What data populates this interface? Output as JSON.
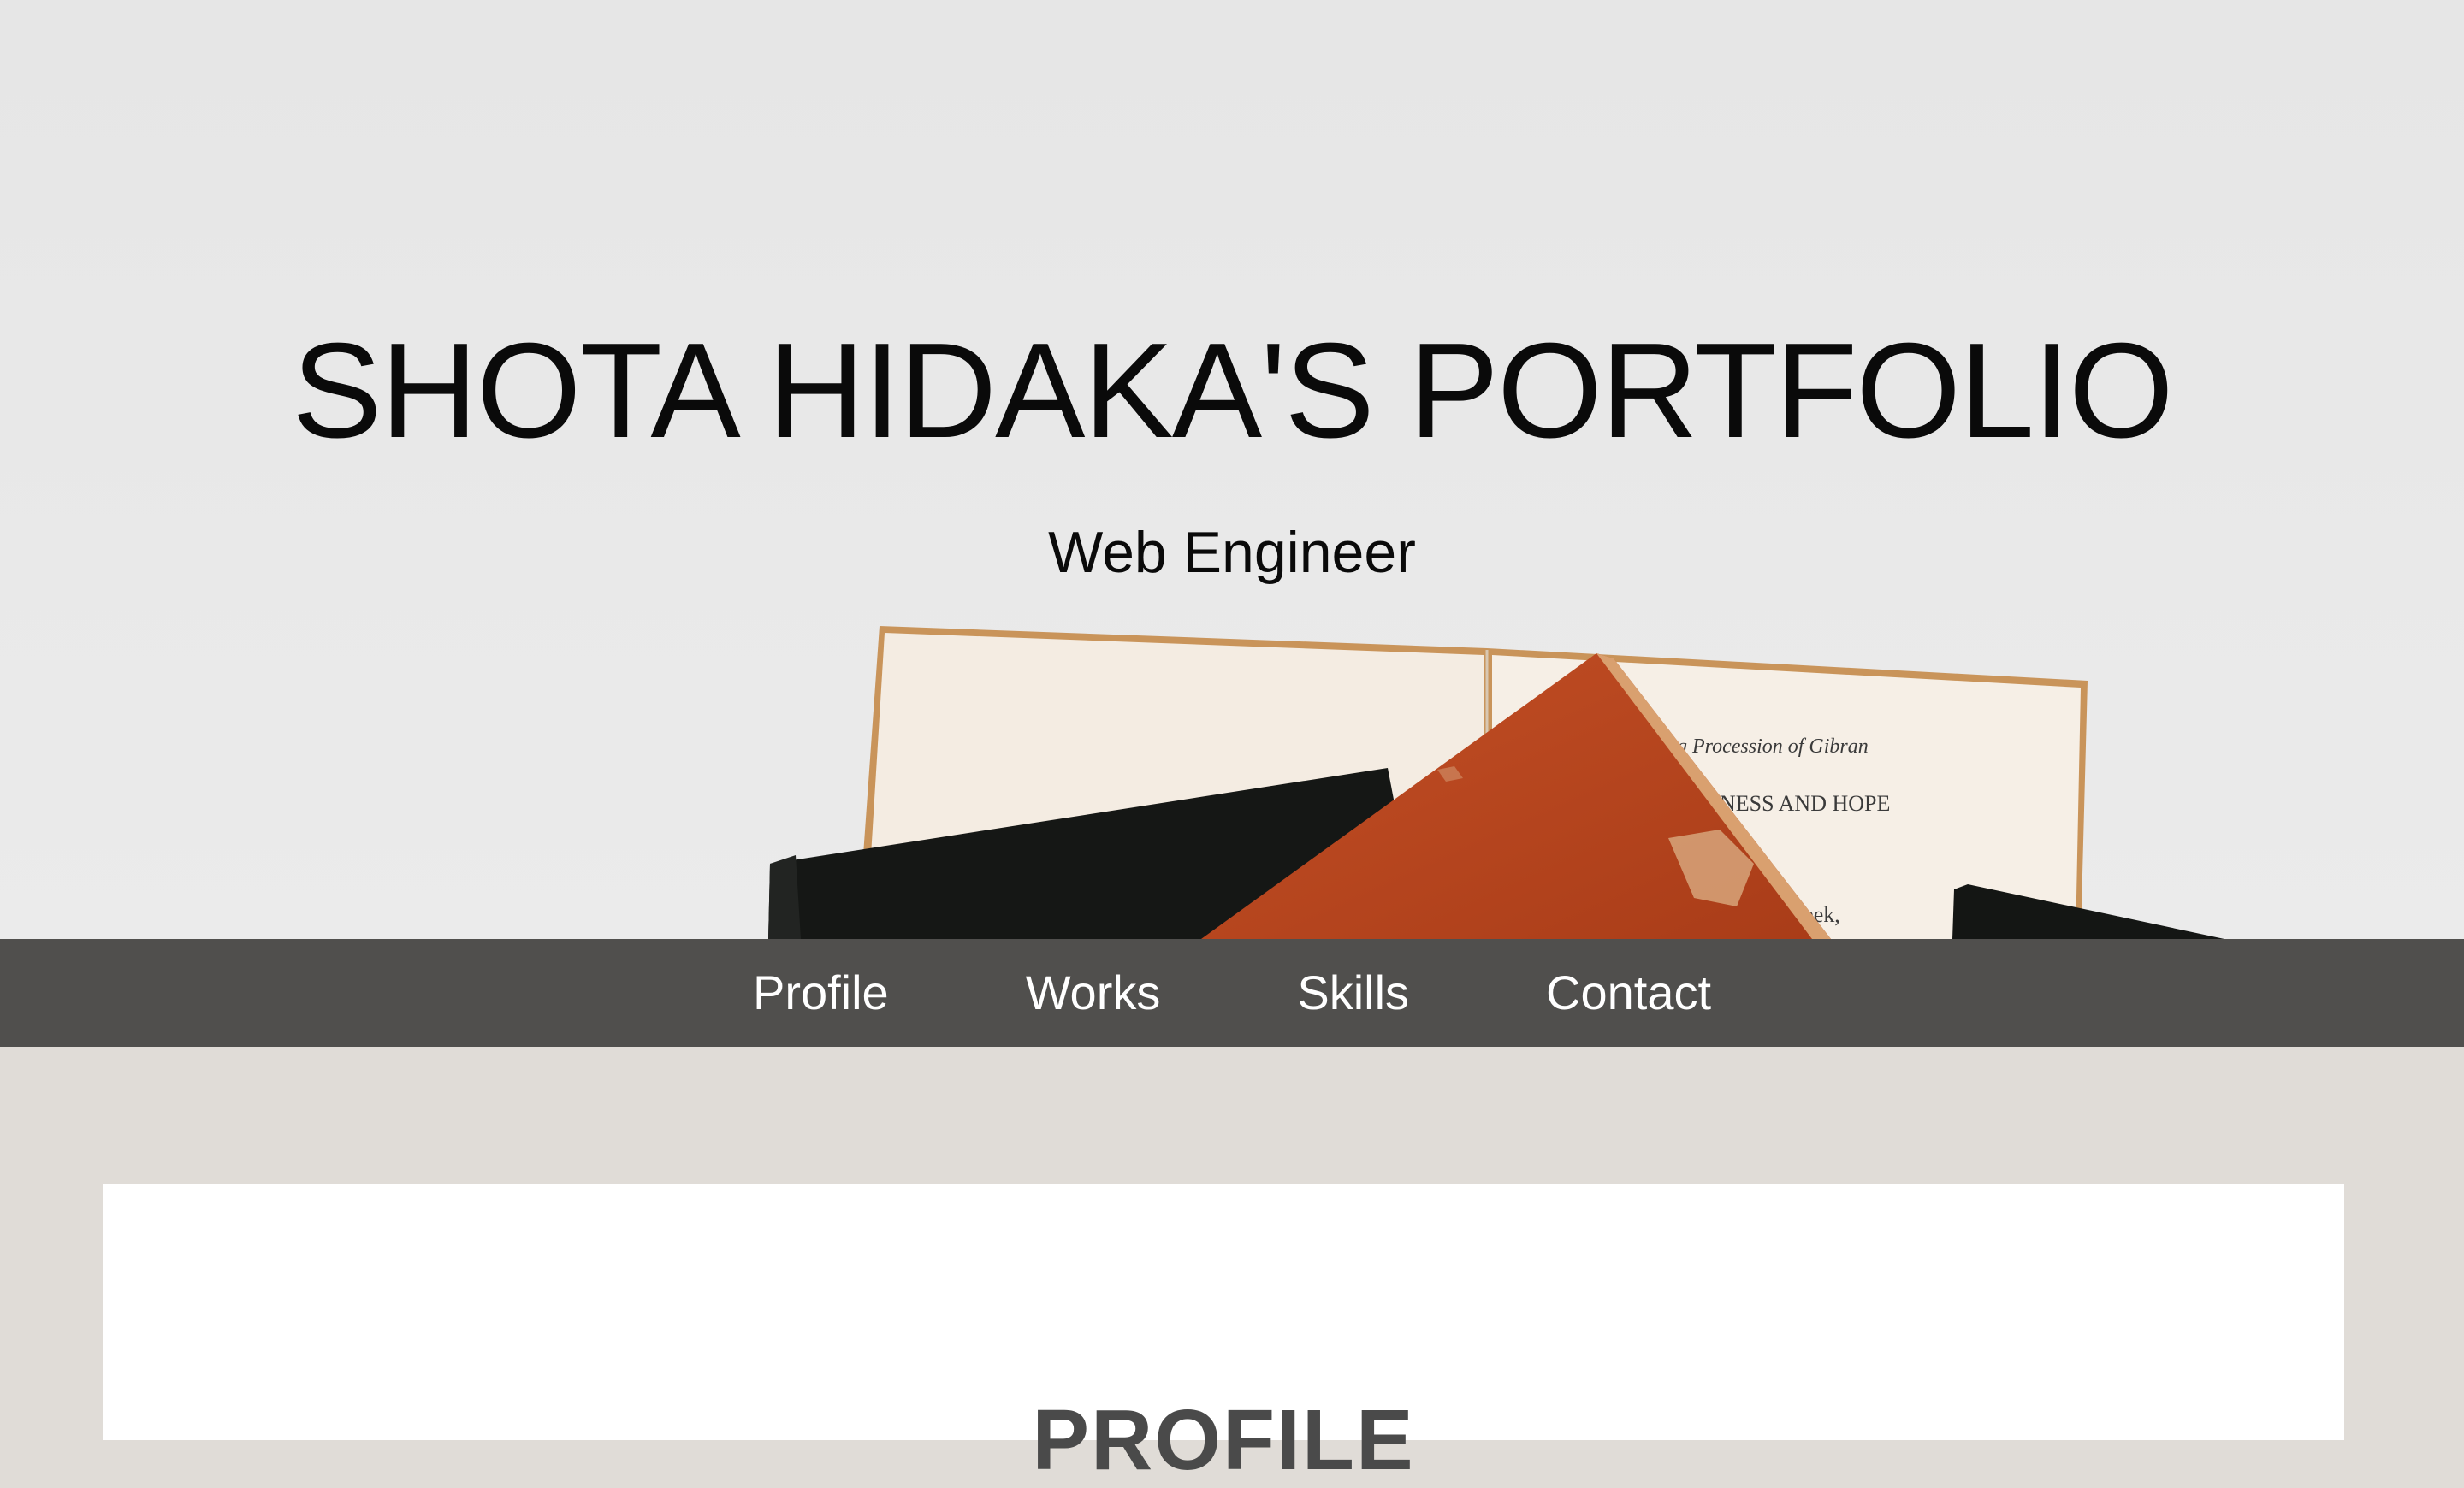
{
  "hero": {
    "title": "SHOTA HIDAKA'S PORTFOLIO",
    "subtitle": "Web Engineer"
  },
  "nav": {
    "items": [
      {
        "label": "Profile"
      },
      {
        "label": "Works"
      },
      {
        "label": "Skills"
      },
      {
        "label": "Contact"
      }
    ]
  },
  "profile": {
    "title": "PROFILE"
  },
  "colors": {
    "nav_bg": "#504f4d",
    "page_bg": "#e0dcd7",
    "hero_bg": "#e8e8e8",
    "book_orange": "#b8461f"
  }
}
